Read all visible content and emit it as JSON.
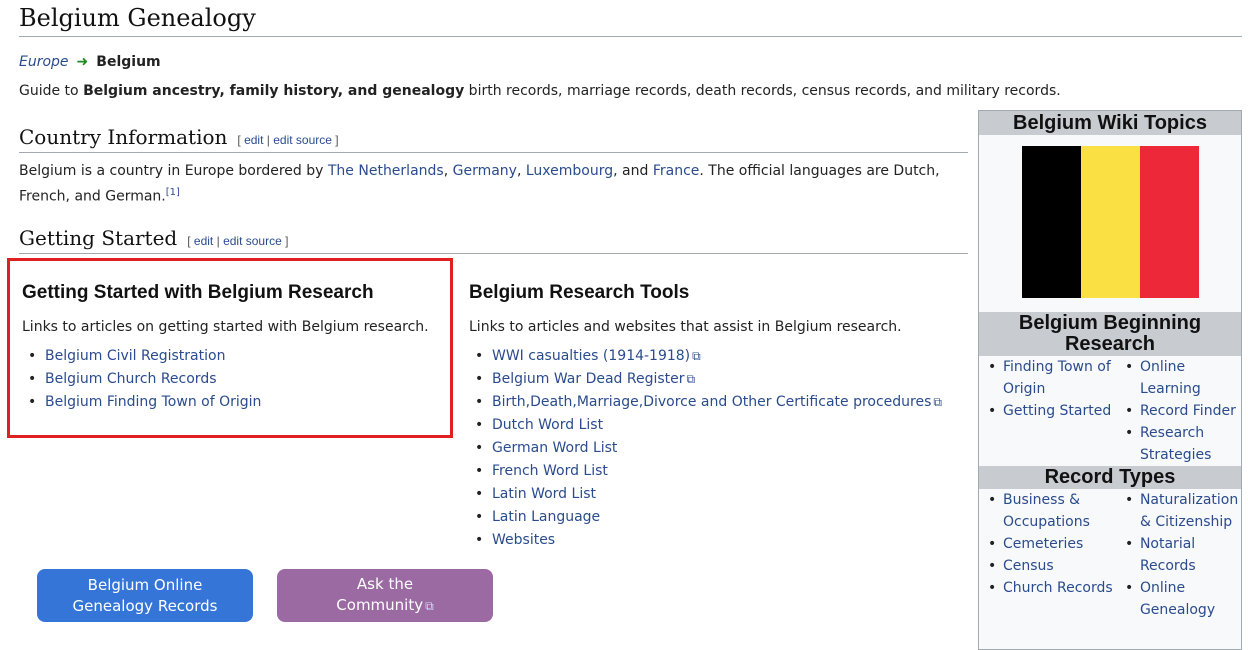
{
  "page": {
    "title": "Belgium Genealogy"
  },
  "breadcrumb": {
    "parent": "Europe",
    "arrow": "➜",
    "current": "Belgium"
  },
  "intro": {
    "prefix": "Guide to ",
    "bold": "Belgium ancestry, family history, and genealogy",
    "suffix": " birth records, marriage records, death records, census records, and military records."
  },
  "edit_links": {
    "open": "[ ",
    "edit": "edit",
    "sep": " | ",
    "edit_source": "edit source",
    "close": " ]"
  },
  "country": {
    "heading": "Country Information",
    "text_1": "Belgium is a country in Europe bordered by ",
    "link_netherlands": "The Netherlands",
    "comma_1": ", ",
    "link_germany": "Germany",
    "comma_2": ", ",
    "link_luxembourg": "Luxembourg",
    "and": ", and ",
    "link_france": "France",
    "text_2": ". The official languages are Dutch, French, and German.",
    "footnote": "[1]"
  },
  "getting_started": {
    "heading": "Getting Started",
    "col_title": "Getting Started with Belgium Research",
    "col_desc": "Links to articles on getting started with Belgium research.",
    "links": [
      "Belgium Civil Registration",
      "Belgium Church Records",
      "Belgium Finding Town of Origin"
    ]
  },
  "tools": {
    "col_title": "Belgium Research Tools",
    "col_desc": "Links to articles and websites that assist in Belgium research.",
    "links": [
      "WWI casualties (1914-1918)",
      "Belgium War Dead Register",
      "Birth,Death,Marriage,Divorce and Other Certificate procedures",
      "Dutch Word List",
      "German Word List",
      "French Word List",
      "Latin Word List",
      "Latin Language",
      "Websites"
    ],
    "external_icon": "external-link-icon"
  },
  "buttons": {
    "online_line1": "Belgium Online",
    "online_line2": "Genealogy Records",
    "ask_line1": "Ask the",
    "ask_line2": "Community"
  },
  "sidebar": {
    "topics_heading": "Belgium Wiki Topics",
    "begin_heading": "Belgium Beginning Research",
    "begin_col1": [
      "Finding Town of Origin",
      "Getting Started"
    ],
    "begin_col2": [
      "Online Learning",
      "Record Finder",
      "Research Strategies"
    ],
    "records_heading": "Record Types",
    "records_col1": [
      "Business & Occupations",
      "Cemeteries",
      "Census",
      "Church Records"
    ],
    "records_col2": [
      "Naturalization & Citizenship",
      "Notarial Records",
      "Online Genealogy"
    ]
  },
  "colors": {
    "link": "#2a4b8d",
    "highlight_border": "#e02020",
    "button_blue": "#3575d8",
    "button_purple": "#9b6aa3",
    "flag_black": "#000000",
    "flag_yellow": "#fae042",
    "flag_red": "#ed2939"
  }
}
